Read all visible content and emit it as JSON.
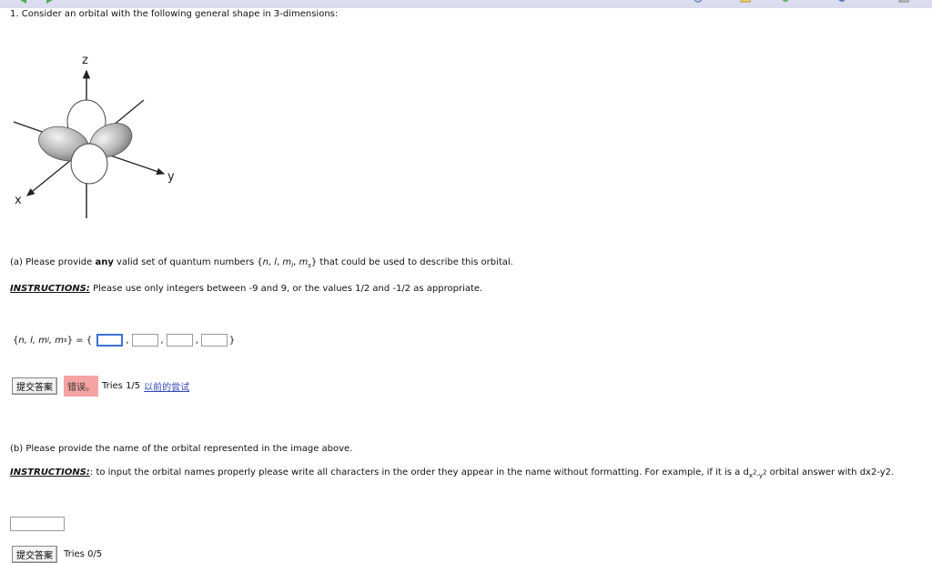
{
  "question_title": "1. Consider an orbital with the following general shape in 3-dimensions:",
  "figure": {
    "axis_z": "z",
    "axis_y": "y",
    "axis_x": "x"
  },
  "part_a": {
    "prompt_pre": "(a) Please provide ",
    "prompt_bold": "any",
    "prompt_mid": " valid set of quantum numbers {",
    "qn_n": "n",
    "qn_l": "l",
    "qn_ml": "m",
    "qn_ml_sub": "l",
    "qn_ms": "m",
    "qn_ms_sub": "s",
    "prompt_post": "} that could be used to describe this orbital.",
    "instructions_label": "INSTRUCTIONS:",
    "instructions_text": " Please use only integers between -9 and 9, or the values 1/2 and -1/2 as appropriate.",
    "set_open": "{",
    "set_close": "}",
    "equals": "= {",
    "end_brace": "}",
    "inputs": [
      "",
      "",
      "",
      ""
    ],
    "submit_label": "提交答案",
    "status_wrong": "错误。",
    "tries": "Tries 1/5",
    "previous_tries_link": "以前的尝试"
  },
  "part_b": {
    "prompt": "(b) Please provide the name of the orbital represented in the image above.",
    "instructions_label": "INSTRUCTIONS:",
    "instructions_text_1": ": to input the orbital names properly please write all characters in the order they appear in the name without formatting. For example, if it is a d",
    "instructions_sub": "x",
    "instructions_sup1": "2",
    "instructions_mid": "-y",
    "instructions_sup2": "2",
    "instructions_text_2": " orbital answer with dx2-y2.",
    "input_value": "",
    "submit_label": "提交答案",
    "tries": "Tries 0/5"
  }
}
